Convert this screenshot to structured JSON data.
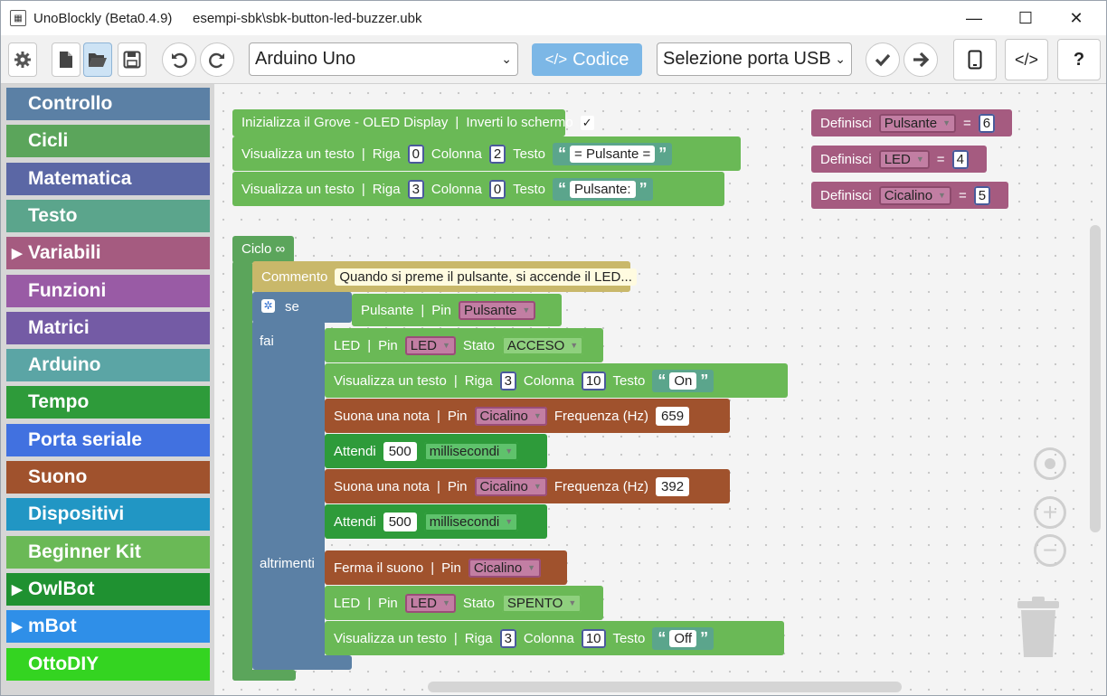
{
  "titlebar": {
    "app_title": "UnoBlockly (Beta0.4.9)",
    "file_title": "esempi-sbk\\sbk-button-led-buzzer.ubk",
    "minimize": "—",
    "maximize": "☐",
    "close": "✕"
  },
  "toolbar": {
    "board": "Arduino Uno",
    "code_label": "Codice",
    "port": "Selezione porta USB",
    "help_label": "?"
  },
  "toolbox": {
    "categories": [
      {
        "label": "Controllo",
        "color": "#5b80a5"
      },
      {
        "label": "Cicli",
        "color": "#5ba55b"
      },
      {
        "label": "Matematica",
        "color": "#5b67a5"
      },
      {
        "label": "Testo",
        "color": "#5ba58c"
      },
      {
        "label": "Variabili",
        "color": "#a55b80",
        "arrow": "▶"
      },
      {
        "label": "Funzioni",
        "color": "#995ba5"
      },
      {
        "label": "Matrici",
        "color": "#745ba5"
      },
      {
        "label": "Arduino",
        "color": "#5ba5a5"
      },
      {
        "label": "Tempo",
        "color": "#2e9b3a"
      },
      {
        "label": "Porta seriale",
        "color": "#4171e0"
      },
      {
        "label": "Suono",
        "color": "#a0522d"
      },
      {
        "label": "Dispositivi",
        "color": "#2196c4"
      },
      {
        "label": "Beginner Kit",
        "color": "#6ab956"
      },
      {
        "label": "OwlBot",
        "color": "#1f9131",
        "arrow": "▶"
      },
      {
        "label": "mBot",
        "color": "#2f8fe8",
        "arrow": "▶"
      },
      {
        "label": "OttoDIY",
        "color": "#34d421"
      }
    ]
  },
  "blocks": {
    "init": {
      "line1_a": "Inizializza il Grove - OLED Display",
      "sep": "|",
      "line1_b": "Inverti lo schermo",
      "check": "✓",
      "show1": "Visualizza un testo",
      "riga": "Riga",
      "colonna": "Colonna",
      "testo": "Testo",
      "r1": "0",
      "c1": "2",
      "t1": "= Pulsante =",
      "r2": "3",
      "c2": "0",
      "t2": "Pulsante:"
    },
    "defs": [
      {
        "label": "Definisci",
        "name": "Pulsante",
        "eq": "=",
        "value": "6"
      },
      {
        "label": "Definisci",
        "name": "LED",
        "eq": "=",
        "value": "4"
      },
      {
        "label": "Definisci",
        "name": "Cicalino",
        "eq": "=",
        "value": "5"
      }
    ],
    "loop": {
      "label": "Ciclo ∞",
      "comment_label": "Commento",
      "comment_text": "Quando si preme il pulsante, si accende il LED...",
      "if_label": "se",
      "do_label": "fai",
      "else_label": "altrimenti",
      "cond_label": "Pulsante",
      "pin": "Pin",
      "cond_pin": "Pulsante",
      "led": "LED",
      "stato": "Stato",
      "acceso": "ACCESO",
      "spento": "SPENTO",
      "show": "Visualizza un testo",
      "riga": "Riga",
      "colonna": "Colonna",
      "testo": "Testo",
      "on_r": "3",
      "on_c": "10",
      "on_t": "On",
      "off_r": "3",
      "off_c": "10",
      "off_t": "Off",
      "play": "Suona una nota",
      "buzzer": "Cicalino",
      "freq": "Frequenza (Hz)",
      "f1": "659",
      "f2": "392",
      "wait": "Attendi",
      "ms1": "500",
      "ms2": "500",
      "unit": "millisecondi",
      "stop": "Ferma il suono"
    }
  }
}
